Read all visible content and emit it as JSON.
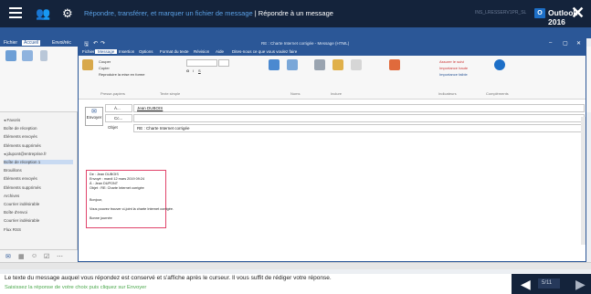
{
  "tutorial": {
    "title_highlight": "Répondre, transférer, et marquer un fichier de message",
    "title_rest": " | Répondre à un message",
    "app_name": "Outlook 2016",
    "user_hint": "INS_LRESSERV1PR_SL",
    "instruction_line1": "Le texte du message auquel vous répondez est conservé et s'affiche après le curseur. Il vous suffit de rédiger votre réponse.",
    "instruction_line2": "Saisissez la réponse de votre choix puis cliquez sur Envoyer",
    "page_indicator": "5/11",
    "close_glyph": "✕",
    "badge_letter": "O"
  },
  "outlook": {
    "tabs": [
      "Fichier",
      "Accueil",
      "Envoi/réc"
    ],
    "folders": [
      {
        "label": "◂ Favoris",
        "selected": false
      },
      {
        "label": "Boîte de réception",
        "selected": false
      },
      {
        "label": "Éléments envoyés",
        "selected": false
      },
      {
        "label": "Éléments supprimés",
        "selected": false
      },
      {
        "label": "◂ jdupont@entreprise.fr",
        "selected": false
      },
      {
        "label": "Boîte de réception 1",
        "selected": true
      },
      {
        "label": "Brouillons",
        "selected": false
      },
      {
        "label": "Éléments envoyés",
        "selected": false
      },
      {
        "label": "Éléments supprimés",
        "selected": false
      },
      {
        "label": "Archives",
        "selected": false
      },
      {
        "label": "Courrier indésirable",
        "selected": false
      },
      {
        "label": "Boîte d'envoi",
        "selected": false
      },
      {
        "label": "Courrier indésirable",
        "selected": false
      },
      {
        "label": "Flux RSS",
        "selected": false
      }
    ]
  },
  "compose": {
    "window_title": "RE : Charte Internet corrigée - Message (HTML)",
    "tabs": [
      "Fichier",
      "Message",
      "Insertion",
      "Options",
      "Format du texte",
      "Révision",
      "Aide",
      "Dites-nous ce que vous voulez faire"
    ],
    "active_tab": "Message",
    "ribbon_groups": [
      "Presse-papiers",
      "Texte simple",
      "Noms",
      "Inclure",
      "Indicateurs",
      "Compléments"
    ],
    "ribbon_buttons": [
      "Coller",
      "Couper",
      "Copier",
      "Reproduire la mise en forme",
      "Carnet d'adresses",
      "Vérifier les noms",
      "Joindre un fichier",
      "Joindre un élément",
      "Signature",
      "Assigner une stratégie",
      "Assurer le suivi",
      "Importance haute",
      "Importance faible",
      "Compléments Office"
    ],
    "send_label": "Envoyer",
    "to_label": "À...",
    "cc_label": "Cc...",
    "subject_label": "Objet",
    "to_value": "Jean DUBOIS",
    "subject_value": "RE : Charte Internet corrigée",
    "quoted": {
      "from": "De : Jean DUBOIS",
      "sent": "Envoyé : mardi 12 mars 2019 09:24",
      "to": "À : Jean DUPONT",
      "subject": "Objet : RE: Charte Internet corrigée",
      "greeting": "Bonjour,",
      "body": "Vous pouvez trouver ci-joint la charte Internet corrigée.",
      "signature": "Bonne journée"
    }
  },
  "colors": {
    "tutorial_bar": "#14233b",
    "outlook_blue": "#2b5797",
    "highlight_frame": "#e0446b",
    "instruction_green": "#4aa84b"
  }
}
